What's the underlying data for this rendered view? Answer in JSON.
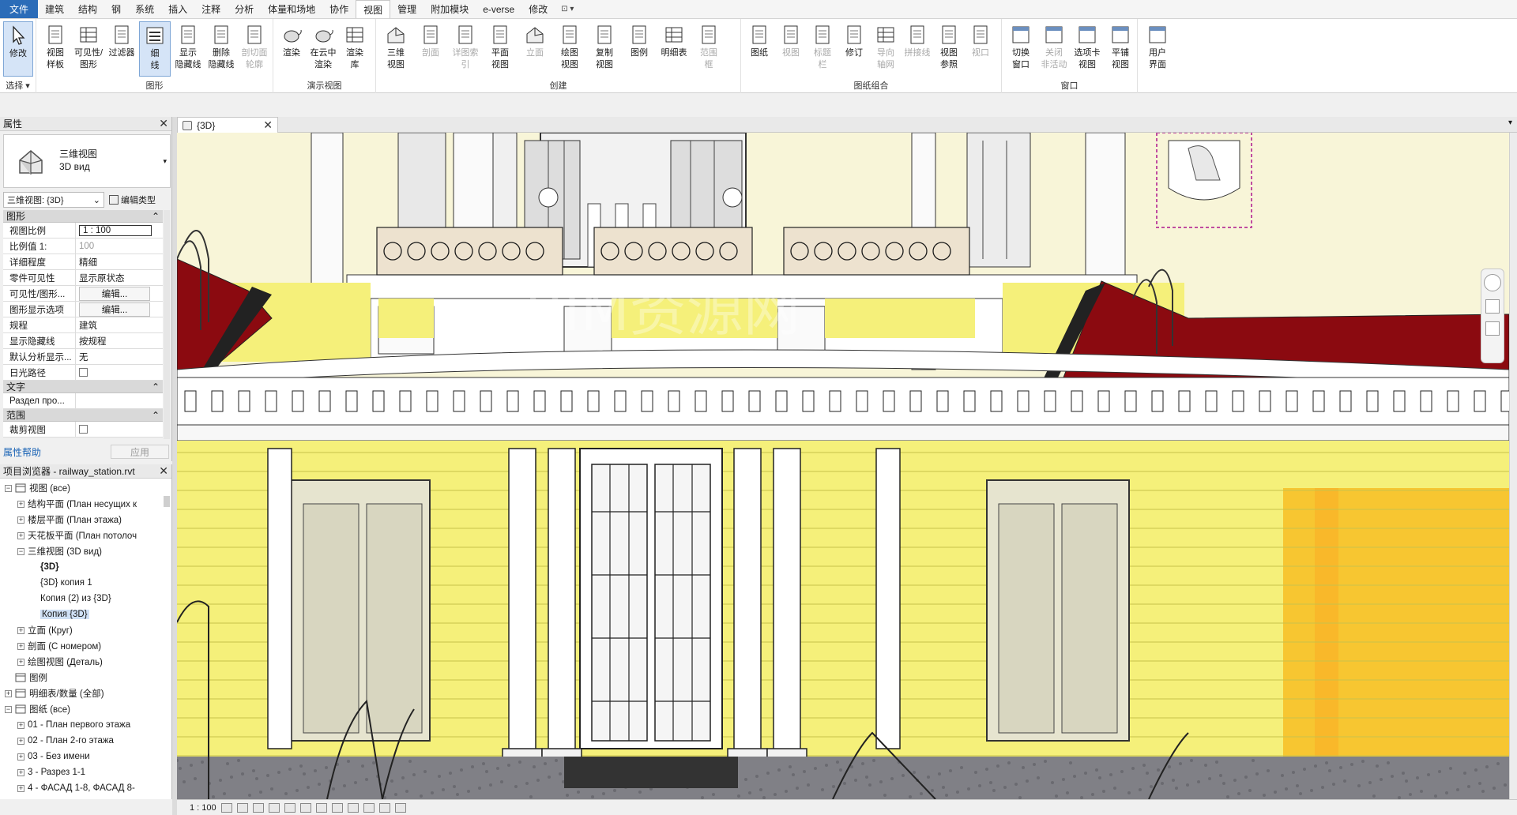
{
  "menu": {
    "file": "文件",
    "tabs": [
      "建筑",
      "结构",
      "钢",
      "系统",
      "插入",
      "注释",
      "分析",
      "体量和场地",
      "协作",
      "视图",
      "管理",
      "附加模块",
      "e-verse",
      "修改"
    ],
    "active_tab": "视图"
  },
  "ribbon": {
    "select": {
      "modify": "修改",
      "panel": "选择 ▾"
    },
    "graphics": {
      "panel": "图形",
      "buttons": [
        "视图\n样板",
        "可见性/\n图形",
        "过滤器",
        "细\n线",
        "显示\n隐藏线",
        "删除\n隐藏线",
        "剖切面\n轮廓"
      ]
    },
    "presentation": {
      "panel": "演示视图",
      "buttons": [
        "渲染",
        "在云中\n渲染",
        "渲染\n库"
      ]
    },
    "create": {
      "panel": "创建",
      "buttons": [
        "三维\n视图",
        "剖面",
        "详图索引",
        "平面\n视图",
        "立面",
        "绘图\n视图",
        "复制\n视图",
        "图例",
        "明细表",
        "范围\n框"
      ]
    },
    "sheet": {
      "panel": "图纸组合",
      "buttons": [
        "图纸",
        "视图",
        "标题\n栏",
        "修订",
        "导向\n轴网",
        "拼接线",
        "视图\n参照",
        "视口"
      ]
    },
    "windows": {
      "panel": "窗口",
      "buttons": [
        "切换\n窗口",
        "关闭\n非活动",
        "选项卡\n视图",
        "平铺\n视图"
      ]
    },
    "ui": {
      "buttons": [
        "用户\n界面"
      ]
    }
  },
  "properties": {
    "title": "属性",
    "type_name_line1": "三维视图",
    "type_name_line2": "3D вид",
    "instance": "三维视图: {3D}",
    "edit_type": "编辑类型",
    "categories": [
      {
        "name": "图形",
        "rows": [
          {
            "name": "视图比例",
            "value": "1 : 100",
            "style": "boxed"
          },
          {
            "name": "比例值 1:",
            "value": "100",
            "style": "grey"
          },
          {
            "name": "详细程度",
            "value": "精细"
          },
          {
            "name": "零件可见性",
            "value": "显示原状态"
          },
          {
            "name": "可见性/图形...",
            "value": "编辑...",
            "style": "btn"
          },
          {
            "name": "图形显示选项",
            "value": "编辑...",
            "style": "btn"
          },
          {
            "name": "规程",
            "value": "建筑"
          },
          {
            "name": "显示隐藏线",
            "value": "按规程"
          },
          {
            "name": "默认分析显示...",
            "value": "无"
          },
          {
            "name": "日光路径",
            "value": "",
            "style": "checkbox"
          }
        ]
      },
      {
        "name": "文字",
        "rows": [
          {
            "name": "Раздел про...",
            "value": ""
          }
        ]
      },
      {
        "name": "范围",
        "rows": [
          {
            "name": "裁剪视图",
            "value": "",
            "style": "checkbox"
          }
        ]
      }
    ],
    "help": "属性帮助",
    "apply": "应用"
  },
  "browser": {
    "title": "项目浏览器 - railway_station.rvt",
    "items": [
      {
        "label": "视图 (все)",
        "level": 0,
        "toggle": "−",
        "icon": "views"
      },
      {
        "label": "结构平面 (План несущих к",
        "level": 1,
        "toggle": "+"
      },
      {
        "label": "楼层平面 (План этажа)",
        "level": 1,
        "toggle": "+"
      },
      {
        "label": "天花板平面 (План потолоч",
        "level": 1,
        "toggle": "+"
      },
      {
        "label": "三维视图 (3D вид)",
        "level": 1,
        "toggle": "−"
      },
      {
        "label": "{3D}",
        "level": 2,
        "toggle": "",
        "current": true
      },
      {
        "label": "{3D} копия 1",
        "level": 2,
        "toggle": ""
      },
      {
        "label": "Копия (2) из {3D}",
        "level": 2,
        "toggle": ""
      },
      {
        "label": "Копия {3D}",
        "level": 2,
        "toggle": "",
        "selected": true
      },
      {
        "label": "立面 (Круг)",
        "level": 1,
        "toggle": "+"
      },
      {
        "label": "剖面 (С номером)",
        "level": 1,
        "toggle": "+"
      },
      {
        "label": "绘图视图 (Деталь)",
        "level": 1,
        "toggle": "+"
      },
      {
        "label": "图例",
        "level": 0,
        "toggle": "",
        "icon": "legend"
      },
      {
        "label": "明细表/数量 (全部)",
        "level": 0,
        "toggle": "+",
        "icon": "schedule"
      },
      {
        "label": "图纸 (все)",
        "level": 0,
        "toggle": "−",
        "icon": "sheets"
      },
      {
        "label": "01 - План первого этажа",
        "level": 1,
        "toggle": "+"
      },
      {
        "label": "02 - План 2-го этажа",
        "level": 1,
        "toggle": "+"
      },
      {
        "label": "03 - Без имени",
        "level": 1,
        "toggle": "+"
      },
      {
        "label": "3 - Разрез 1-1",
        "level": 1,
        "toggle": "+"
      },
      {
        "label": "4 - ФАСАД 1-8, ФАСАД 8-",
        "level": 1,
        "toggle": "+"
      }
    ]
  },
  "view_tab": {
    "label": "{3D}"
  },
  "status": {
    "scale": "1 : 100"
  },
  "colors": {
    "wall_yellow": "#f5f07a",
    "roof_red": "#8b0a10",
    "accent": "#2b6cb8"
  }
}
